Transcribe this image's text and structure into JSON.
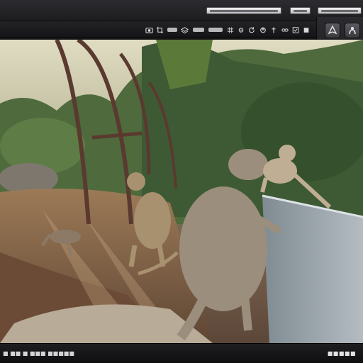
{
  "statusbar": {
    "left_text": "■ ■■ ■ ■■■ ■■■■■",
    "right_text": "■■■■■"
  },
  "icons": {
    "toolbar": [
      "camera-icon",
      "crop-icon",
      "layers-icon",
      "grid-icon",
      "settings-icon",
      "refresh-icon",
      "export-icon",
      "pin-icon",
      "link-icon"
    ],
    "panel": [
      "leaf-icon",
      "shape-icon"
    ]
  },
  "scene": {
    "subjects": [
      "monkeys",
      "greenhouse frame",
      "jungle"
    ]
  },
  "colors": {
    "chrome": "#1d1d20",
    "panel": "#2b2b2f",
    "accent": "#b8b8bc"
  }
}
